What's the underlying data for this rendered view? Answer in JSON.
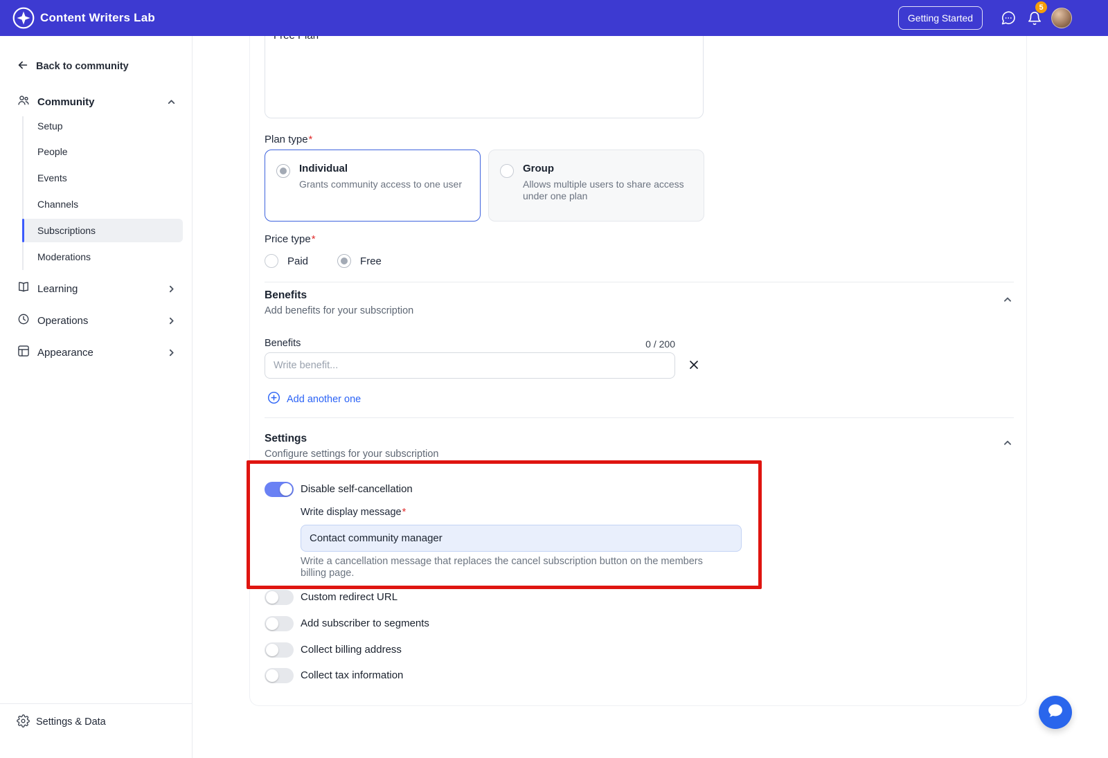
{
  "colors": {
    "header_bg": "#3d3ad1",
    "accent_blue": "#2b63f6",
    "toggle_on_blue": "#6a81f4",
    "annotation_red": "#df1510",
    "badge_amber": "#f59e0b",
    "selected_card_border": "#3e63dd",
    "message_input_bg": "#e9effc"
  },
  "header": {
    "app_title": "Content Writers Lab",
    "getting_started_label": "Getting Started",
    "notification_count": "5"
  },
  "sidebar": {
    "back_label": "Back to community",
    "community": {
      "label": "Community",
      "items": [
        "Setup",
        "People",
        "Events",
        "Channels",
        "Subscriptions",
        "Moderations"
      ],
      "active_item": "Subscriptions"
    },
    "sections": [
      {
        "label": "Learning"
      },
      {
        "label": "Operations"
      },
      {
        "label": "Appearance"
      }
    ],
    "footer_label": "Settings & Data"
  },
  "main": {
    "required_mark": "*",
    "plan_name_value": "Free Plan",
    "plan_type": {
      "label": "Plan type",
      "individual_title": "Individual",
      "individual_desc": "Grants community access to one user",
      "group_title": "Group",
      "group_desc": "Allows multiple users to share access under one plan",
      "selected": "Individual"
    },
    "price_type": {
      "label": "Price type",
      "paid_label": "Paid",
      "free_label": "Free",
      "selected": "Free"
    },
    "benefits": {
      "section_title": "Benefits",
      "section_subtitle": "Add benefits for your subscription",
      "field_label": "Benefits",
      "char_counter": "0 / 200",
      "input_placeholder": "Write benefit...",
      "add_another_label": "Add another one"
    },
    "settings": {
      "section_title": "Settings",
      "section_subtitle": "Configure settings for your subscription",
      "disable_self_cancellation": {
        "label": "Disable self-cancellation",
        "enabled": true,
        "message_label": "Write display message",
        "message_value": "Contact community manager",
        "help_text": "Write a cancellation message that replaces the cancel subscription button on the members billing page."
      },
      "other_toggles": [
        {
          "label": "Custom redirect URL",
          "enabled": false
        },
        {
          "label": "Add subscriber to segments",
          "enabled": false
        },
        {
          "label": "Collect billing address",
          "enabled": false
        },
        {
          "label": "Collect tax information",
          "enabled": false
        }
      ]
    }
  }
}
